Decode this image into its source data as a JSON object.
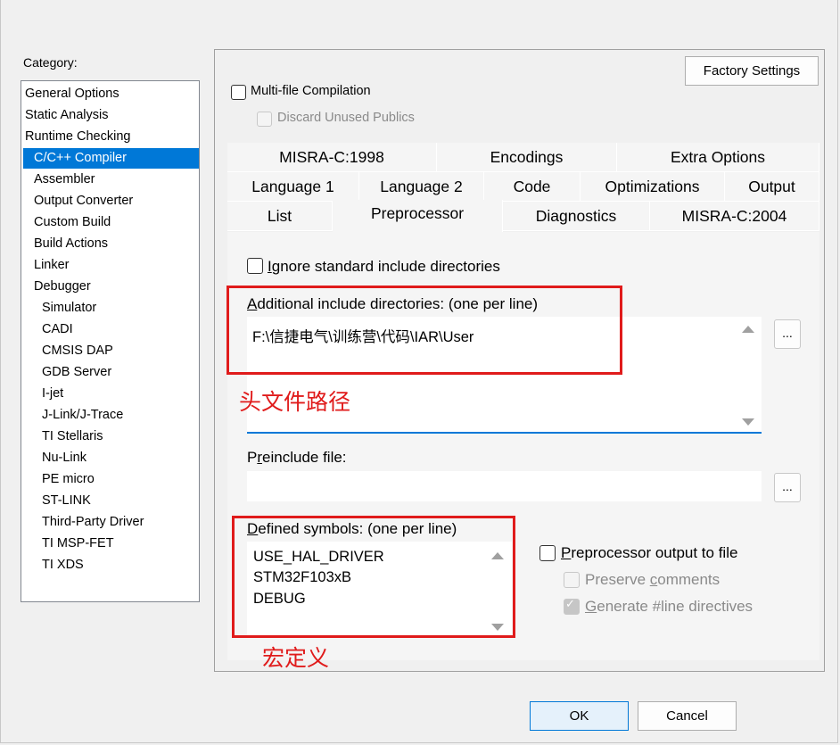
{
  "category": {
    "label": "Category:",
    "items": [
      {
        "label": "General Options"
      },
      {
        "label": "Static Analysis"
      },
      {
        "label": "Runtime Checking"
      },
      {
        "label": "C/C++ Compiler"
      },
      {
        "label": "Assembler"
      },
      {
        "label": "Output Converter"
      },
      {
        "label": "Custom Build"
      },
      {
        "label": "Build Actions"
      },
      {
        "label": "Linker"
      },
      {
        "label": "Debugger"
      },
      {
        "label": "Simulator"
      },
      {
        "label": "CADI"
      },
      {
        "label": "CMSIS DAP"
      },
      {
        "label": "GDB Server"
      },
      {
        "label": "I-jet"
      },
      {
        "label": "J-Link/J-Trace"
      },
      {
        "label": "TI Stellaris"
      },
      {
        "label": "Nu-Link"
      },
      {
        "label": "PE micro"
      },
      {
        "label": "ST-LINK"
      },
      {
        "label": "Third-Party Driver"
      },
      {
        "label": "TI MSP-FET"
      },
      {
        "label": "TI XDS"
      }
    ]
  },
  "panel": {
    "factory_settings": "Factory Settings",
    "multifile": "Multi-file Compilation",
    "discard": "Discard Unused Publics"
  },
  "tabs": {
    "row1": [
      "MISRA-C:1998",
      "Encodings",
      "Extra Options"
    ],
    "row2": [
      "Language 1",
      "Language 2",
      "Code",
      "Optimizations",
      "Output"
    ],
    "row3": [
      "List",
      "Preprocessor",
      "Diagnostics",
      "MISRA-C:2004"
    ]
  },
  "preprocessor": {
    "ignore_std_first": "I",
    "ignore_std_rest": "gnore standard include directories",
    "additional_first": "A",
    "additional_rest": "dditional include directories: (one per line)",
    "include_path": "F:\\信捷电气\\训练营\\代码\\IAR\\User",
    "preinclude_p": "P",
    "preinclude_r": "r",
    "preinclude_e": "e",
    "preinclude_rest": "include file:",
    "defined_first": "D",
    "defined_rest": "efined symbols: (one per line)",
    "symbols": [
      "USE_HAL_DRIVER",
      "STM32F103xB",
      "DEBUG"
    ],
    "pp_output_first": "P",
    "pp_output_rest": "reprocessor output to file",
    "preserve_a": "Preserve ",
    "preserve_c": "c",
    "preserve_b": "omments",
    "generate_g": "G",
    "generate_rest": "enerate #line directives",
    "dots": "..."
  },
  "annotations": {
    "header_path": "头文件路径",
    "macro": "宏定义",
    "color": "#e01b1b"
  },
  "footer": {
    "ok": "OK",
    "cancel": "Cancel"
  }
}
